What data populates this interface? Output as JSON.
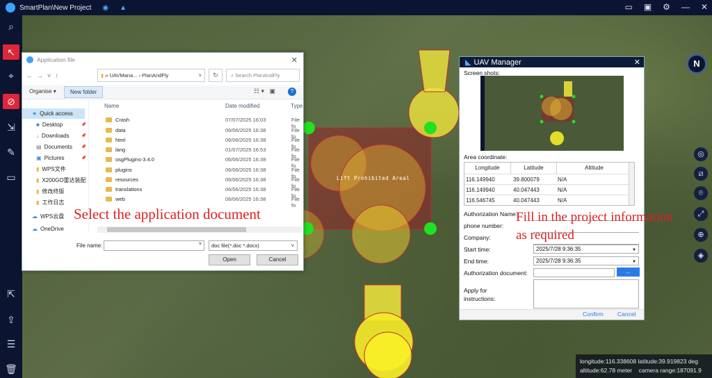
{
  "app": {
    "title": "SmartPlan\\New Project"
  },
  "map": {
    "zone_label": "Lift Prohibited Areal",
    "compass": "N",
    "status": {
      "longitude": "longitude:116.338608",
      "latitude": "latitude:39.919823 deg",
      "altitude": "altitude:62.78 meter",
      "camera": "camera range:187091.9"
    }
  },
  "file_dialog": {
    "title": "Application file",
    "breadcrumb": [
      "UAVMana...",
      "PlanAndFly"
    ],
    "search_placeholder": "Search PlanAndFly",
    "organise": "Organise",
    "new_folder": "New folder",
    "nav": [
      "Quick access",
      "Desktop",
      "Downloads",
      "Documents",
      "Pictures",
      "WPS文件",
      "X200GO雷达装配",
      "修改终版",
      "工作日志",
      "WPS云盘",
      "OneDrive"
    ],
    "columns": {
      "name": "Name",
      "date": "Date modified",
      "type": "Type"
    },
    "files": [
      {
        "name": "Crash",
        "date": "07/07/2025 16:03",
        "type": "File fo"
      },
      {
        "name": "data",
        "date": "06/06/2025 16:38",
        "type": "File fo"
      },
      {
        "name": "html",
        "date": "06/06/2025 16:38",
        "type": "File fo"
      },
      {
        "name": "lang",
        "date": "01/07/2025 16:53",
        "type": "File fo"
      },
      {
        "name": "osgPlugins-3.4.0",
        "date": "06/06/2025 16:38",
        "type": "File fo"
      },
      {
        "name": "plugins",
        "date": "06/06/2025 16:38",
        "type": "File fo"
      },
      {
        "name": "resources",
        "date": "06/06/2025 16:38",
        "type": "File fo"
      },
      {
        "name": "translations",
        "date": "06/06/2025 16:38",
        "type": "File fo"
      },
      {
        "name": "web",
        "date": "06/06/2025 16:38",
        "type": "File fo"
      }
    ],
    "filename_label": "File name:",
    "filename_value": "",
    "filetype": "doc file(*.doc *.docx)",
    "open": "Open",
    "cancel": "Cancel"
  },
  "uav": {
    "title": "UAV Manager",
    "screenshots": "Screen shots:",
    "area": "Area coordinate:",
    "columns": [
      "Longitude",
      "Latitude",
      "Altitude"
    ],
    "rows": [
      [
        "116.149940",
        "39.800079",
        "N/A"
      ],
      [
        "116.149940",
        "40.047443",
        "N/A"
      ],
      [
        "116.546745",
        "40.047443",
        "N/A"
      ]
    ],
    "auth_name": "Authorization Name:",
    "phone": "phone number:",
    "company": "Company:",
    "start": "Start time:",
    "start_val": "2025/7/28 9:36:35",
    "end": "End time:",
    "end_val": "2025/7/28 9:36:35",
    "doc": "Authorization document:",
    "browse": "...",
    "apply": "Apply for",
    "apply2": "instructions:",
    "confirm": "Confirm",
    "cancel": "Cancel"
  },
  "annotations": {
    "a1": "Select the application document",
    "a2_line1": "Fill in the project information",
    "a2_line2": "as required"
  }
}
